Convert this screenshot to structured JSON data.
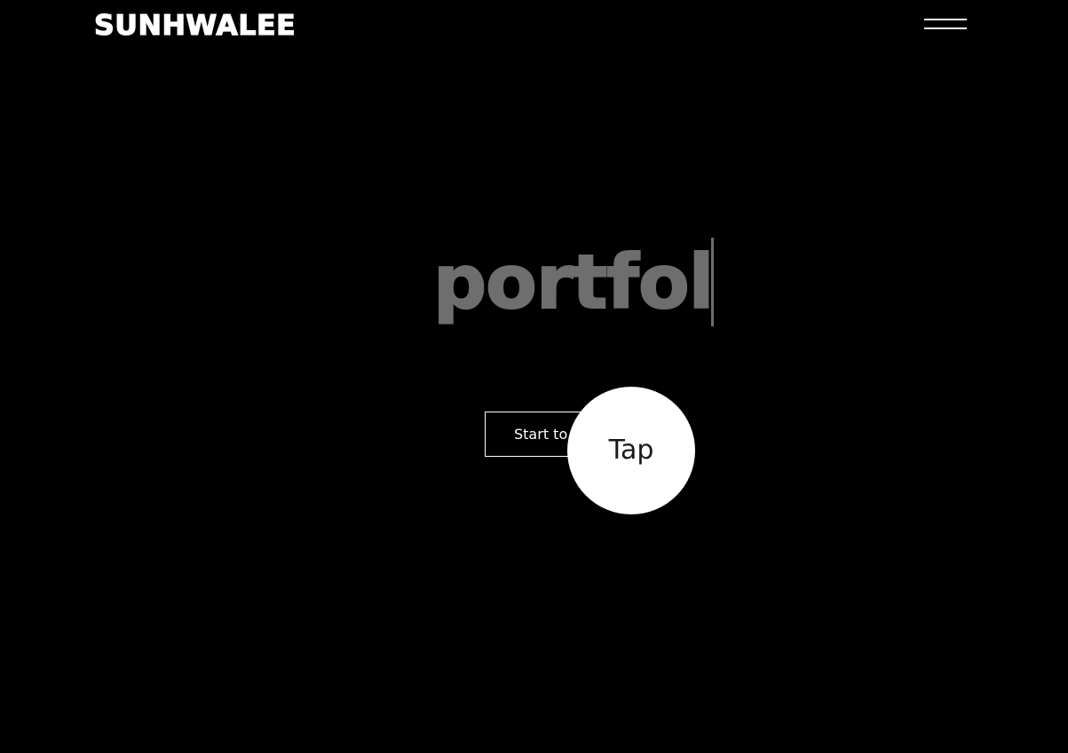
{
  "header": {
    "logo_text": "SUNHWALEE",
    "menu_icon": "hamburger-menu-icon"
  },
  "hero": {
    "typed_word": "portfol",
    "cursor_icon": "text-caret"
  },
  "cta": {
    "start_label": "Start to",
    "tap_label": "Tap"
  },
  "colors": {
    "background": "#000000",
    "logo": "#ffffff",
    "hero_text": "#6e6e6e",
    "tap_circle": "#ffffff",
    "tap_text": "#1a1a1a"
  }
}
